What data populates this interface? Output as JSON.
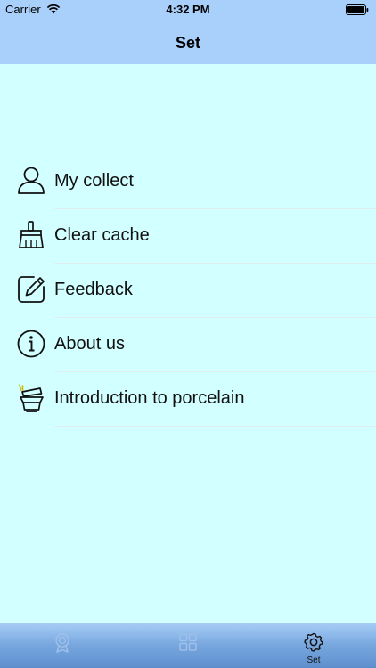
{
  "status_bar": {
    "carrier": "Carrier",
    "time": "4:32 PM"
  },
  "nav": {
    "title": "Set"
  },
  "menu": [
    {
      "label": "My collect",
      "icon": "person-icon"
    },
    {
      "label": "Clear cache",
      "icon": "broom-icon"
    },
    {
      "label": "Feedback",
      "icon": "edit-icon"
    },
    {
      "label": "About us",
      "icon": "info-icon"
    },
    {
      "label": "Introduction to porcelain",
      "icon": "porcelain-icon"
    }
  ],
  "tab_bar": {
    "tabs": [
      {
        "label": "",
        "icon": "badge-icon"
      },
      {
        "label": "",
        "icon": "grid-icon"
      },
      {
        "label": "Set",
        "icon": "gear-icon",
        "selected": true
      }
    ]
  },
  "colors": {
    "background": "#d2ffff",
    "nav": "#a9d0fb",
    "tab_bar": "#7aa9e0"
  }
}
